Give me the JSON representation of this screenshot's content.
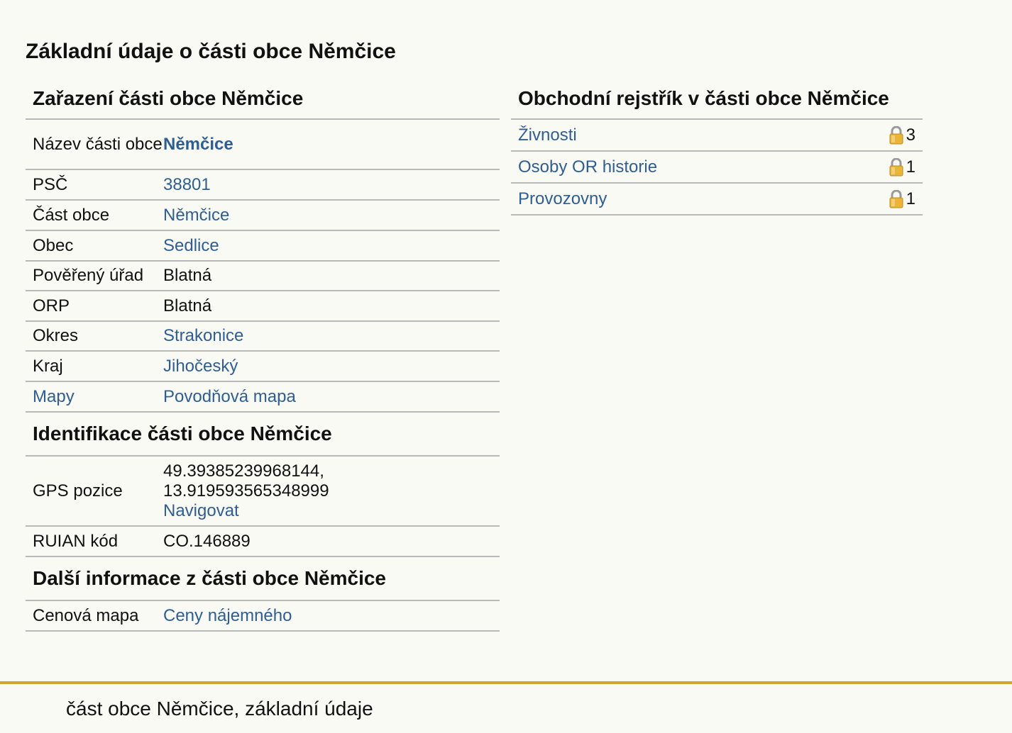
{
  "page_title": "Základní údaje o části obce Němčice",
  "zarazeni": {
    "heading": "Zařazení části obce Němčice",
    "rows": [
      {
        "label": "Název části obce",
        "value": "Němčice",
        "value_link": true,
        "value_bold": true
      },
      {
        "label": "PSČ",
        "value": "38801",
        "value_link": true
      },
      {
        "label": "Část obce",
        "value": "Němčice",
        "value_link": true
      },
      {
        "label": "Obec",
        "value": "Sedlice",
        "value_link": true
      },
      {
        "label": "Pověřený úřad",
        "value": "Blatná",
        "value_link": false
      },
      {
        "label": "ORP",
        "value": "Blatná",
        "value_link": false
      },
      {
        "label": "Okres",
        "value": "Strakonice",
        "value_link": true
      },
      {
        "label": "Kraj",
        "value": "Jihočeský",
        "value_link": true
      },
      {
        "label": "Mapy",
        "label_link": true,
        "value": "Povodňová mapa",
        "value_link": true
      }
    ]
  },
  "identifikace": {
    "heading": "Identifikace části obce Němčice",
    "gps_label": "GPS pozice",
    "gps_lat": "49.39385239968144,",
    "gps_lon": "13.919593565348999",
    "navigate_label": "Navigovat",
    "ruian_label": "RUIAN kód",
    "ruian_value": "CO.146889"
  },
  "dalsi": {
    "heading": "Další informace z části obce Němčice",
    "price_label": "Cenová mapa",
    "price_value": "Ceny nájemného"
  },
  "obchodni": {
    "heading": "Obchodní rejstřík v části obce Němčice",
    "items": [
      {
        "label": "Živnosti",
        "count": "3",
        "icon": "lock-icon"
      },
      {
        "label": "Osoby OR historie",
        "count": "1",
        "icon": "lock-icon"
      },
      {
        "label": "Provozovny",
        "count": "1",
        "icon": "lock-icon"
      }
    ]
  },
  "footer": {
    "text": "část obce Němčice, základní údaje"
  },
  "colors": {
    "background": "#fafaf5",
    "link": "#2e5e93",
    "divider": "#b9b9b9",
    "footer_accent": "#d4a32c",
    "lock_body": "#e8b53a"
  }
}
